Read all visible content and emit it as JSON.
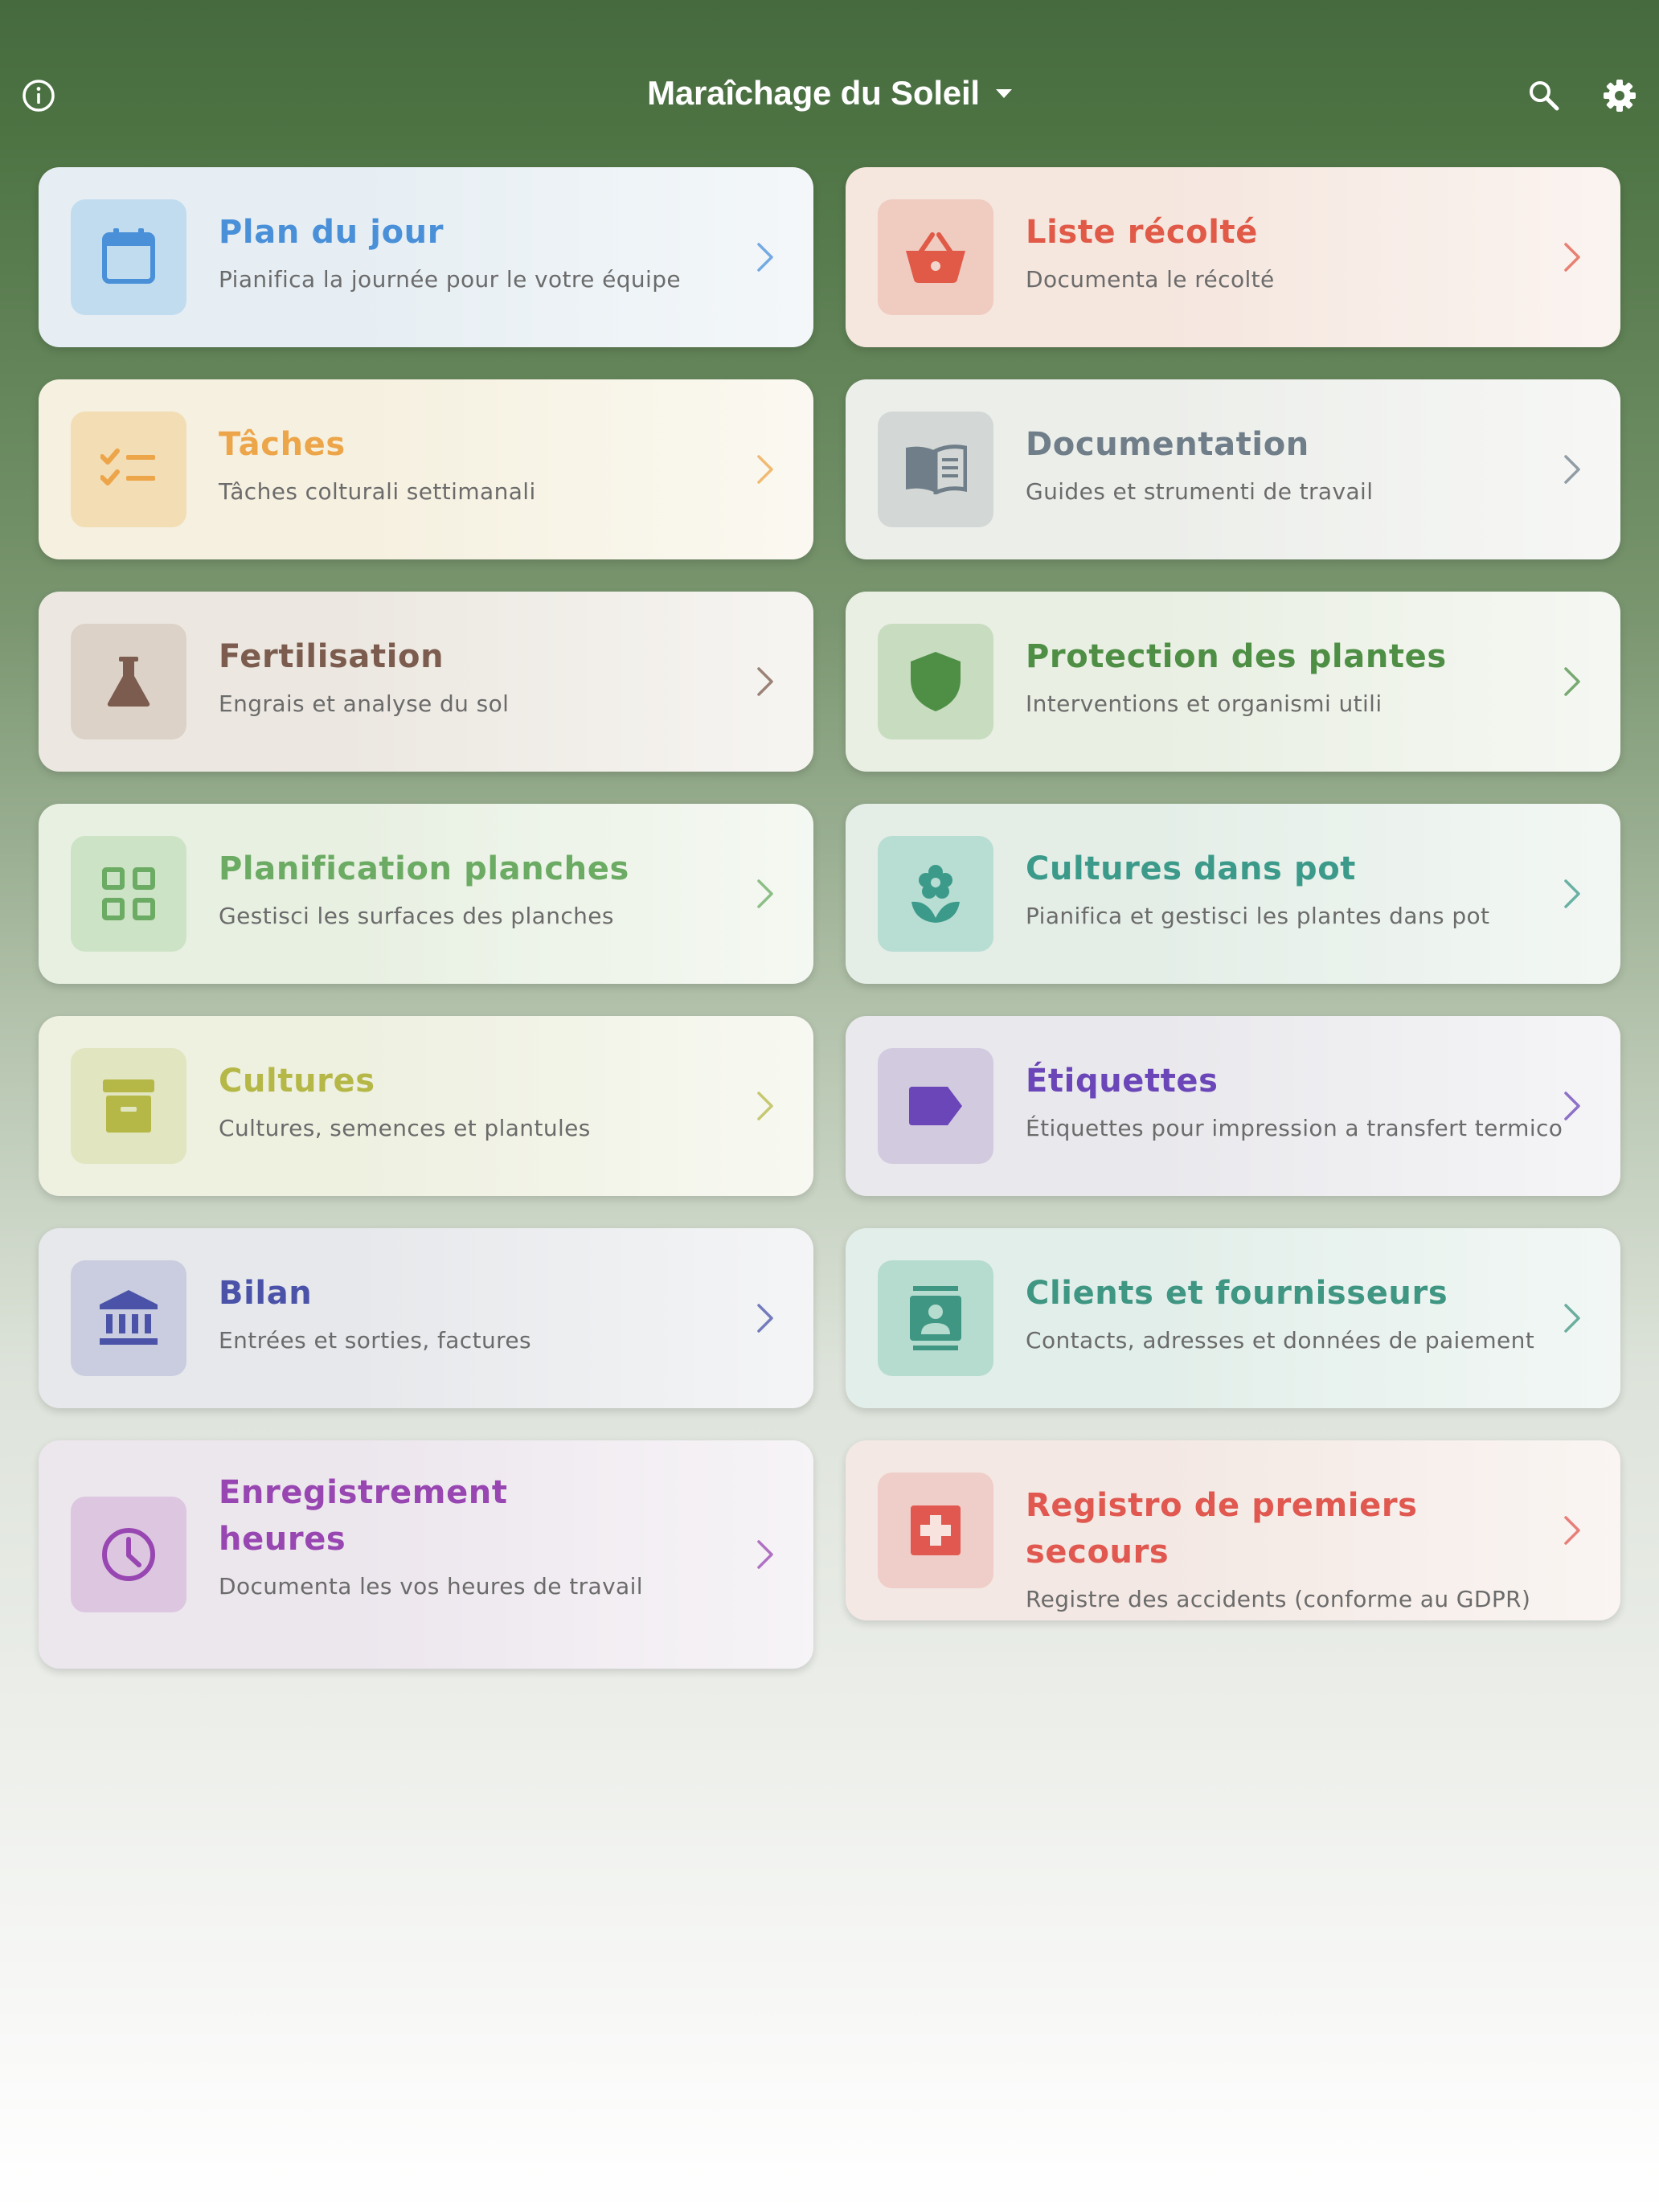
{
  "header": {
    "title": "Maraîchage du Soleil",
    "info_icon": "info-circle-icon",
    "dropdown_icon": "caret-down-icon",
    "search_icon": "search-icon",
    "settings_icon": "gear-icon"
  },
  "cards": [
    {
      "title": "Plan du jour",
      "subtitle": "Pianifica la journée pour le votre équipe",
      "icon": "calendar-icon",
      "color": "#4a90d9",
      "bg": "#e6eef3",
      "tile": "#c2dcef"
    },
    {
      "title": "Liste récolté",
      "subtitle": "Documenta le récolté",
      "icon": "basket-icon",
      "color": "#e05a47",
      "bg": "#f5e6de",
      "tile": "#efcbc0"
    },
    {
      "title": "Tâches",
      "subtitle": "Tâches colturali settimanali",
      "icon": "checklist-icon",
      "color": "#eda54a",
      "bg": "#f5f0df",
      "tile": "#f3ddb5"
    },
    {
      "title": "Documentation",
      "subtitle": "Guides et strumenti de travail",
      "icon": "book-icon",
      "color": "#6f7e89",
      "bg": "#eceeea",
      "tile": "#d3d7d5"
    },
    {
      "title": "Fertilisation",
      "subtitle": "Engrais et analyse du sol",
      "icon": "flask-icon",
      "color": "#7c5c4e",
      "bg": "#ece8e1",
      "tile": "#dcd2c8"
    },
    {
      "title": "Protection des plantes",
      "subtitle": "Interventions et organismi utili",
      "icon": "shield-icon",
      "color": "#4e8f45",
      "bg": "#e9efe3",
      "tile": "#c8dcc0"
    },
    {
      "title": "Planification planches",
      "subtitle": "Gestisci les surfaces des planches",
      "icon": "grid-icon",
      "color": "#6bab63",
      "bg": "#e8f0e2",
      "tile": "#cde3c6"
    },
    {
      "title": "Cultures dans pot",
      "subtitle": "Pianifica et gestisci les plantes dans pot",
      "icon": "flower-icon",
      "color": "#3c9a8a",
      "bg": "#e4eee7",
      "tile": "#b8ddd3"
    },
    {
      "title": "Cultures",
      "subtitle": "Cultures, semences et plantules",
      "icon": "archive-icon",
      "color": "#b5b847",
      "bg": "#eef0e0",
      "tile": "#e1e5c0"
    },
    {
      "title": "Étiquettes",
      "subtitle": "Étiquettes pour impression a transfert termico",
      "icon": "label-icon",
      "color": "#6b46b8",
      "bg": "#e9e8ec",
      "tile": "#d2cbe0"
    },
    {
      "title": "Bilan",
      "subtitle": "Entrées et sorties, factures",
      "icon": "bank-icon",
      "color": "#4a53a8",
      "bg": "#e6e8eb",
      "tile": "#cacddf"
    },
    {
      "title": "Clients et fournisseurs",
      "subtitle": "Contacts, adresses et données de paiement",
      "icon": "contact-book-icon",
      "color": "#3f9682",
      "bg": "#e2eee9",
      "tile": "#b6dcd0"
    },
    {
      "title": "Enregistrement heures",
      "subtitle": "Documenta les vos heures de travail",
      "icon": "clock-icon",
      "color": "#9846b1",
      "bg": "#ece6ed",
      "tile": "#dcc6e0"
    },
    {
      "title": "Registro de premiers secours",
      "subtitle": "Registre des accidents (conforme au GDPR)",
      "icon": "first-aid-icon",
      "color": "#e0584f",
      "bg": "#f3e8e3",
      "tile": "#efcdc8"
    }
  ]
}
